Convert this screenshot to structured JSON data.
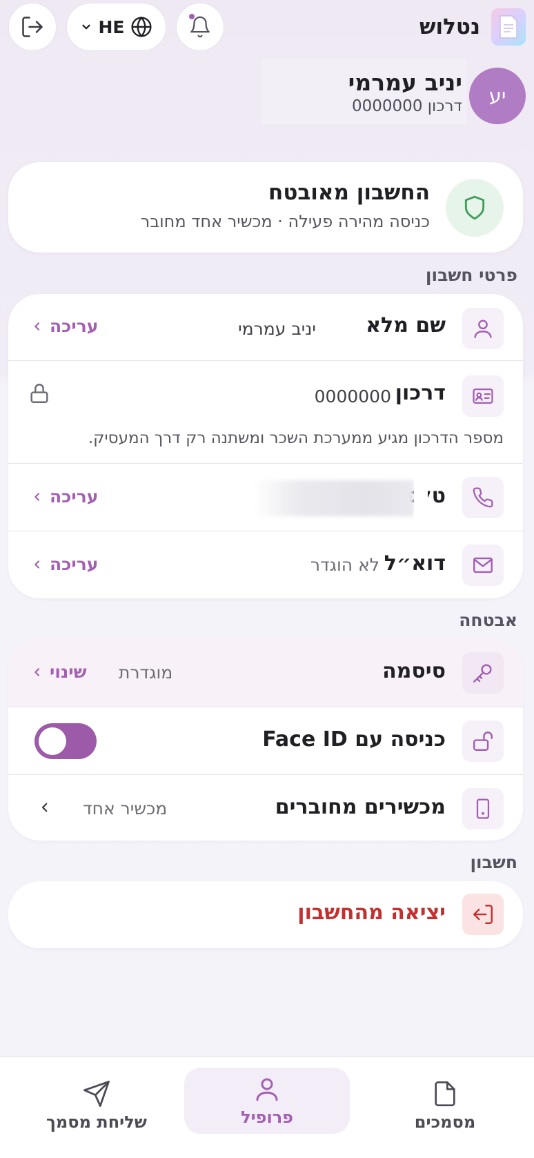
{
  "header": {
    "app_name": "נטלוש",
    "language": "HE"
  },
  "user": {
    "initials": "יע",
    "name": "יניב עמרמי",
    "passport_line": "דרכון 0000000"
  },
  "security_status": {
    "title": "החשבון מאובטח",
    "subtitle": "כניסה מהירה פעילה · מכשיר אחד מחובר"
  },
  "sections": {
    "account_details": "פרטי חשבון",
    "security": "אבטחה",
    "account": "חשבון"
  },
  "account_details": {
    "full_name_label": "שם מלא",
    "full_name_value": "יניב עמרמי",
    "full_name_action": "עריכה",
    "passport_label": "דרכון",
    "passport_value": "0000000",
    "passport_note": "מספר הדרכון מגיע ממערכת השכר ומשתנה רק דרך המעסיק.",
    "phone_label": "טלפון",
    "phone_action": "עריכה",
    "email_label": "דוא״ל",
    "email_value": "לא הוגדר",
    "email_action": "עריכה"
  },
  "security": {
    "password_label": "סיסמה",
    "password_value": "מוגדרת",
    "password_action": "שינוי",
    "faceid_label": "כניסה עם Face ID",
    "faceid_enabled": true,
    "devices_label": "מכשירים מחוברים",
    "devices_value": "מכשיר אחד"
  },
  "account": {
    "logout_label": "יציאה מהחשבון"
  },
  "bottom_nav": {
    "documents": "מסמכים",
    "profile": "פרופיל",
    "send_document": "שליחת מסמך"
  },
  "colors": {
    "accent": "#a35fb2",
    "danger": "#c2302f",
    "success": "#3f9d5a"
  }
}
